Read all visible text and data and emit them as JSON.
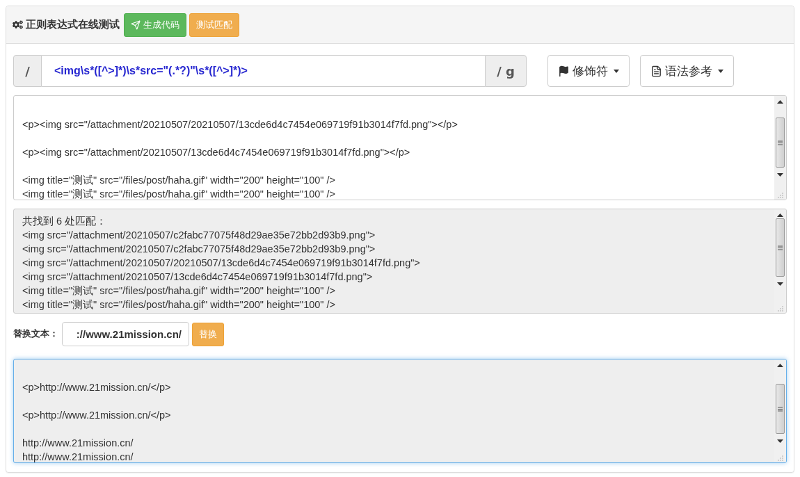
{
  "header": {
    "title": "正则表达式在线测试",
    "buttons": [
      {
        "label": "生成代码",
        "kind": "success"
      },
      {
        "label": "测试匹配",
        "kind": "warning"
      }
    ]
  },
  "regex": {
    "open": "/",
    "pattern": "<img\\s*([^>]*)\\s*src=\"(.*?)\"\\s*([^>]*)>",
    "flags": "/ g"
  },
  "menus": [
    {
      "label": "修饰符"
    },
    {
      "label": "语法参考"
    }
  ],
  "source": {
    "paragraphs": [
      [
        "<p><img src=\"/attachment/20210507/20210507/13cde6d4c7454e069719f91b3014f7fd.png\"></p>"
      ],
      [
        "<p><img src=\"/attachment/20210507/13cde6d4c7454e069719f91b3014f7fd.png\"></p>"
      ],
      [
        "<img title=\"测试\" src=\"/files/post/haha.gif\" width=\"200\" height=\"100\" />",
        "<img title=\"测试\" src=\"/files/post/haha.gif\" width=\"200\" height=\"100\" />"
      ]
    ]
  },
  "result": {
    "lines": [
      "共找到 6 处匹配：",
      "<img src=\"/attachment/20210507/c2fabc77075f48d29ae35e72bb2d93b9.png\">",
      "<img src=\"/attachment/20210507/c2fabc77075f48d29ae35e72bb2d93b9.png\">",
      "<img src=\"/attachment/20210507/20210507/13cde6d4c7454e069719f91b3014f7fd.png\">",
      "<img src=\"/attachment/20210507/13cde6d4c7454e069719f91b3014f7fd.png\">",
      "<img title=\"测试\" src=\"/files/post/haha.gif\" width=\"200\" height=\"100\" />",
      "<img title=\"测试\" src=\"/files/post/haha.gif\" width=\"200\" height=\"100\" />"
    ]
  },
  "replace": {
    "label": "替换文本：",
    "value": "://www.21mission.cn/",
    "button": "替换"
  },
  "output": {
    "focused": true,
    "paragraphs": [
      [
        "<p>http://www.21mission.cn/</p>"
      ],
      [
        "<p>http://www.21mission.cn/</p>"
      ],
      [
        "http://www.21mission.cn/",
        "http://www.21mission.cn/"
      ]
    ]
  }
}
